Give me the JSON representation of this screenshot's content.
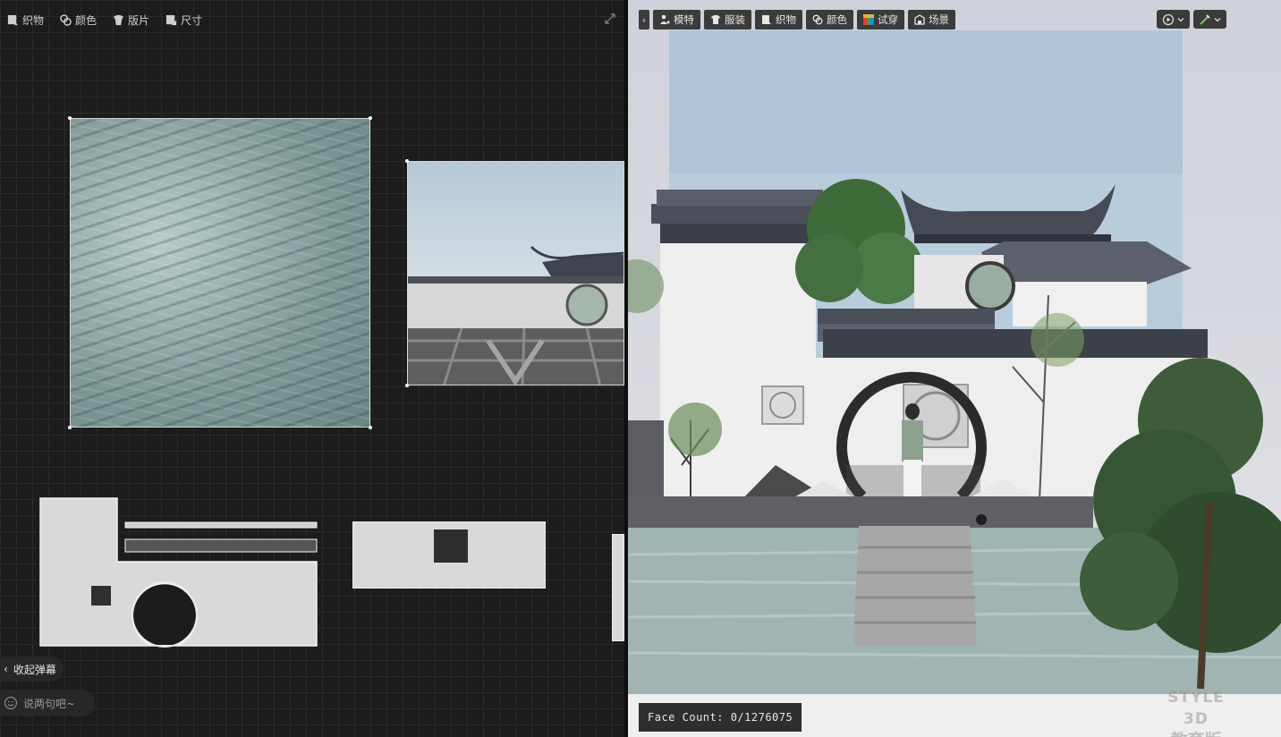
{
  "left_toolbar": {
    "fabric": "织物",
    "color": "颜色",
    "pattern": "版片",
    "size": "尺寸"
  },
  "right_toolbar": {
    "avatar": "模特",
    "garment": "服装",
    "fabric": "织物",
    "color": "颜色",
    "tryon": "试穿",
    "scene": "场景"
  },
  "danmu_toggle": "收起弹幕",
  "chat_placeholder": "说两句吧~",
  "face_count": "Face Count: 0/1276075",
  "watermark": {
    "line1": "STYLE 3D",
    "line2": "教育版"
  },
  "icons": {
    "fabric": "fabric-icon",
    "color": "palette-icon",
    "pattern": "pattern-piece-icon",
    "size": "ruler-icon",
    "avatar": "avatar-icon",
    "garment": "shirt-icon",
    "tryon": "rainbow-icon",
    "scene": "scene-icon",
    "expand": "expand-icon",
    "collapse": "chevron-left-icon",
    "playback": "playback-icon",
    "brush": "brush-icon",
    "chat": "smile-icon"
  },
  "colors": {
    "toolbar_bg": "#3b3b3b",
    "canvas_bg": "#1c1c1c",
    "grid_line": "#2a2a2a",
    "sky": "#bfd1e0",
    "wall_white": "#f0f0f0",
    "roof_dark": "#4a4f5a",
    "water": "#9fb4b3"
  }
}
